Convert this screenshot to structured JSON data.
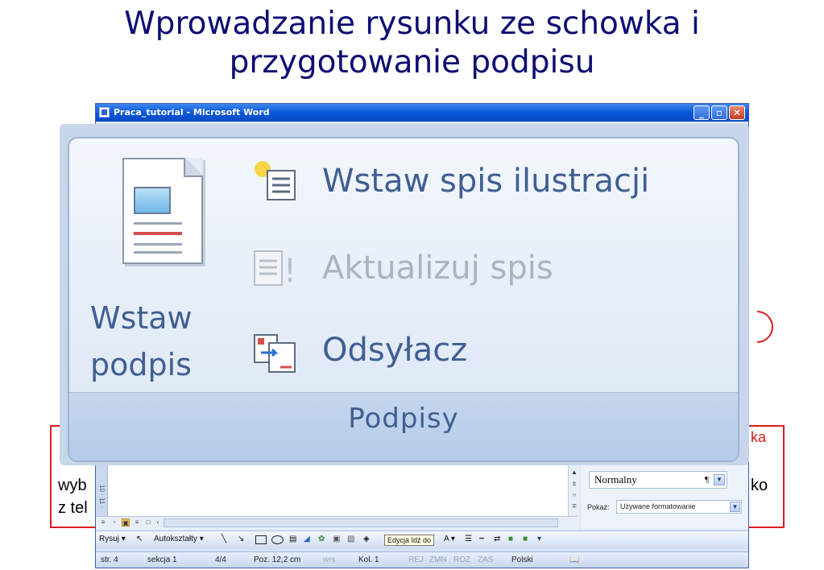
{
  "slide": {
    "title_line1": "Wprowadzanie rysunku ze schowka i",
    "title_line2": "przygotowanie podpisu",
    "text_left_1": "wyb",
    "text_left_2": "z tel",
    "text_right_1": "ko",
    "text_right_top": "ka"
  },
  "window": {
    "title": "Praca_tutorial - Microsoft Word",
    "minimize_glyph": "_",
    "maximize_glyph": "▫",
    "close_glyph": "✕"
  },
  "ribbon": {
    "big_button_line1": "Wstaw",
    "big_button_line2": "podpis",
    "cmd_insert_toc": "Wstaw spis ilustracji",
    "cmd_update_toc": "Aktualizuj spis",
    "cmd_cross_ref": "Odsyłacz",
    "group_label": "Podpisy"
  },
  "ruler": {
    "vertical_text": "10 · 11 ·"
  },
  "task_pane": {
    "style_value": "Normalny",
    "pilcrow": "¶",
    "show_label": "Pokaż:",
    "show_value": "Używane formatowanie"
  },
  "draw_toolbar": {
    "draw_label": "Rysuj",
    "autoshapes_label": "Autokształty",
    "tooltip": "Edycja Idź do"
  },
  "status_bar": {
    "page": "str. 4",
    "section": "sekcja 1",
    "pages": "4/4",
    "position": "Poz. 12,2 cm",
    "line": "wrs",
    "column": "Kol. 1",
    "rec": "REJ",
    "trk": "ZMN",
    "ext": "ROZ",
    "ovr": "ZAS",
    "language": "Polski"
  },
  "colors": {
    "title": "#0d0d73",
    "ribbon_text": "#3f5f92",
    "disabled_text": "#a9b3c2",
    "annotation_red": "#d81e1e",
    "titlebar_blue": "#0a58d9"
  }
}
